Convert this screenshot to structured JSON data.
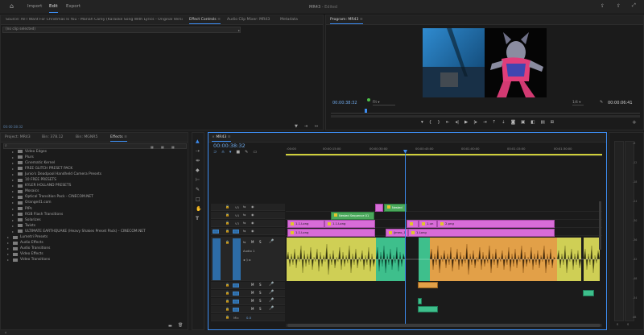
{
  "menu": {
    "home_icon": "home-icon",
    "tabs": [
      "Import",
      "Edit",
      "Export"
    ],
    "active": "Edit",
    "title": "MR43",
    "status": "- Edited"
  },
  "source_panel": {
    "tabs": [
      "Source: All I Want For Christmas Is You - Mariah Carey (Karaoke Song With Lyrics - Original Version).mp3",
      "Effect Controls",
      "Audio Clip Mixer: MR43",
      "Metadata"
    ],
    "no_clip": "(no clip selected)",
    "timecode": "00:00:38:32"
  },
  "program": {
    "tab": "Program: MR43",
    "timecode": "00:00:38:32",
    "fit": "Fit",
    "ratio": "1/4",
    "duration": "00:00:06:41"
  },
  "project_panel": {
    "tabs": [
      "Project: MR43",
      "Bin: 378.12",
      "Bin: MGNR5",
      "Effects"
    ],
    "active": "Effects",
    "items": [
      {
        "label": "Video Edges",
        "indent": 1,
        "folder": true
      },
      {
        "label": "Plurs",
        "indent": 1,
        "folder": true
      },
      {
        "label": "Cinematic Kernel",
        "indent": 1,
        "folder": true
      },
      {
        "label": "FREE GLITCH PRESET PACK",
        "indent": 1,
        "folder": true
      },
      {
        "label": "Junio's Deadpool Handheld Camera Presets",
        "indent": 1,
        "folder": true
      },
      {
        "label": "10 FREE PRESETS",
        "indent": 1,
        "folder": true
      },
      {
        "label": "KYLER HOLLAND PRESETS",
        "indent": 1,
        "folder": true
      },
      {
        "label": "Mosaics",
        "indent": 1,
        "folder": true
      },
      {
        "label": "Optical Transition Pack - CINECOM.NET",
        "indent": 1,
        "folder": true
      },
      {
        "label": "Orange41.com",
        "indent": 1,
        "folder": true
      },
      {
        "label": "PIPs",
        "indent": 1,
        "folder": true
      },
      {
        "label": "RGB Flash Transitions",
        "indent": 1,
        "folder": true
      },
      {
        "label": "Solarizes",
        "indent": 1,
        "folder": true
      },
      {
        "label": "Twists",
        "indent": 1,
        "folder": true
      },
      {
        "label": "ULTIMATE EARTHQUAKE (Heavy Shakes Preset Pack) - CINECOM.NET",
        "indent": 1,
        "folder": true
      },
      {
        "label": "Lumetri Presets",
        "indent": 0,
        "folder": true
      },
      {
        "label": "Audio Effects",
        "indent": 0,
        "folder": true
      },
      {
        "label": "Audio Transitions",
        "indent": 0,
        "folder": true
      },
      {
        "label": "Video Effects",
        "indent": 0,
        "folder": true
      },
      {
        "label": "Video Transitions",
        "indent": 0,
        "folder": true
      }
    ]
  },
  "timeline": {
    "tab": "MR43",
    "timecode": "00:00:38:32",
    "ruler": [
      ":00:00",
      "00:00:15:00",
      "00:00:30:00",
      "00:00:45:00",
      "00:01:00:00",
      "00:01:15:00",
      "00:01:30:00"
    ],
    "track_labels": [
      "V5",
      "V4",
      "V3",
      "V2",
      "V1",
      "A1",
      "A2",
      "A3",
      "A4",
      "A5",
      "Mix"
    ],
    "audio_track_name": "Audio 1",
    "mix_value": "0.0",
    "clips": {
      "nested": "Nested",
      "nested_seq": "Nested Sequence 01",
      "c1": "1.1.Long",
      "c2": "1.1.Long",
      "c3": "1.1.Long",
      "c4": "jjmeo_1",
      "c5": "1.Long",
      "c6": "1.un",
      "c7": "2.png",
      "c8": "1.png"
    }
  },
  "tools": [
    "selection-tool",
    "track-select-tool",
    "ripple-edit-tool",
    "razor-tool",
    "slip-tool",
    "pen-tool",
    "rectangle-tool",
    "hand-tool",
    "type-tool"
  ],
  "meter": {
    "labels": [
      "-6",
      "-12",
      "-18",
      "-24",
      "-30",
      "-36",
      "-42",
      "-48",
      "-54",
      "dB"
    ],
    "bottom": [
      "S",
      "S"
    ]
  },
  "colors": {
    "accent": "#3d8cf0",
    "video_clip": "#d86cd8",
    "audio_yellow": "#d8d864",
    "audio_orange": "#e6a14a",
    "audio_green": "#3ebf8c",
    "track_blue": "#2d6ca6"
  }
}
